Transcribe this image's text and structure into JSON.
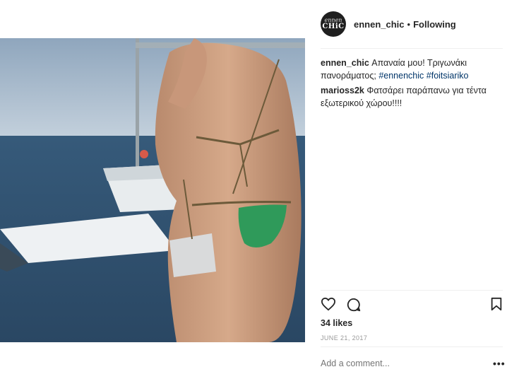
{
  "post": {
    "username": "ennen_chic",
    "separator": "•",
    "follow_status": "Following",
    "avatar_text_top": "ennen",
    "avatar_text_bottom": "CHiC"
  },
  "comments": [
    {
      "user": "ennen_chic",
      "text": "Απαναία μου! Τριγωνάκι πανοράματος; ",
      "tags": [
        "#ennenchic",
        "#foitsiariko"
      ]
    },
    {
      "user": "marioss2k",
      "text": "Φατσάρει παράπανω για τέντα εξωτερικού χώρου!!!!"
    }
  ],
  "actions": {
    "like_icon": "heart-icon",
    "comment_icon": "comment-icon",
    "save_icon": "bookmark-icon"
  },
  "likes": "34 likes",
  "date": "JUNE 21, 2017",
  "comment_input": {
    "placeholder": "Add a comment..."
  },
  "more_label": "•••"
}
